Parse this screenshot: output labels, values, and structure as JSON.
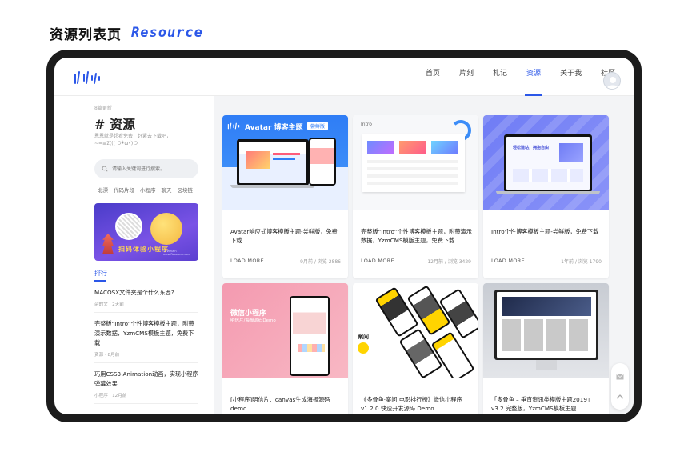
{
  "heading": {
    "zh": "资源列表页",
    "en": "Resource"
  },
  "nav": {
    "items": [
      {
        "label": "首页",
        "active": false
      },
      {
        "label": "片刻",
        "active": false
      },
      {
        "label": "札记",
        "active": false
      },
      {
        "label": "资源",
        "active": true
      },
      {
        "label": "关于我",
        "active": false
      },
      {
        "label": "社区",
        "active": false
      }
    ]
  },
  "sidebar": {
    "update_label": "8篇更新",
    "title": "# 资源",
    "desc_line1": "恩恩就是超看免费，赶紧去下载吧，",
    "desc_line2": "~=≡Σ((( つ•̀ω•́)つ",
    "search_placeholder": "请输入关键词进行搜索。",
    "tags": [
      "北漂",
      "代码片段",
      "小程序",
      "聊天",
      "区块链"
    ],
    "promo_text": "扫码体验小程序",
    "promo_small": "© WeiXin www.Resource.com",
    "rank_title": "排行",
    "rank_items": [
      {
        "title": "MACOSX文件夹是个什么东西?",
        "meta": "杂的文 · 2天前"
      },
      {
        "title": "完整版“Intro”个性博客模板主题，附带演示数据，YzmCMS模板主题，免费下载",
        "meta": "资源 · 8月前"
      },
      {
        "title": "巧用CSS3-Animation动画，实现小程序弹幕效果",
        "meta": "小程序 · 12月前"
      }
    ]
  },
  "cards": [
    {
      "title": "Avatar响应式博客模版主题-尝鲜版，免费下载",
      "load": "LOAD MORE",
      "meta": "9月前 / 浏览 2886",
      "thumb_text": "Avatar 博客主题",
      "thumb_badge": "尝鲜版"
    },
    {
      "title": "完整版“Intro”个性博客模板主题，附带演示数据，YzmCMS模版主题，免费下载",
      "load": "LOAD MORE",
      "meta": "12月前 / 浏览 3429",
      "thumb_text": "Intro"
    },
    {
      "title": "Intro个性博客模板主题-尝鲜版，免费下载",
      "load": "LOAD MORE",
      "meta": "1年前 / 浏览 1790",
      "thumb_text": "轻松建站，拥抱自由"
    },
    {
      "title": "[小程序]明信片、canvas生成海报源码demo",
      "thumb_text": "微信小程序",
      "thumb_sub": "明信片/海报源码Demo"
    },
    {
      "title": "《多骨鱼·案问 电影排行榜》微信小程序v1.2.0 快速开发源码 Demo",
      "thumb_text": "案问"
    },
    {
      "title": "「多骨鱼 – 垂直资讯类模版主题2019」v3.2 完整版，YzmCMS模板主题"
    }
  ],
  "colors": {
    "accent": "#2b57e8",
    "device": "#1c1c1c",
    "content_bg": "#f3f4f6"
  }
}
